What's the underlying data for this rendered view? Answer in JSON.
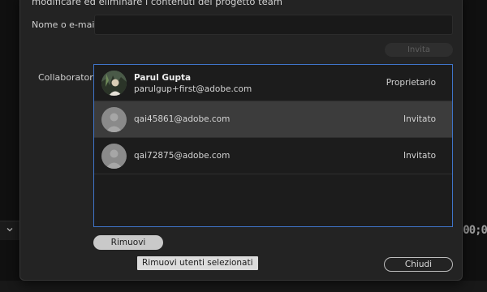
{
  "dialog": {
    "intro_text": "modificare ed eliminare i contenuti del progetto team",
    "email_label": "Nome o e-mail:",
    "email_value": "",
    "email_placeholder": "",
    "invite_label": "Invita",
    "collaborators_label": "Collaboratori:",
    "collaborators": [
      {
        "name": "Parul Gupta",
        "email": "parulgup+first@adobe.com",
        "role": "Proprietario",
        "avatar": "user-photo",
        "selected": false
      },
      {
        "name": "",
        "email": "qai45861@adobe.com",
        "role": "Invitato",
        "avatar": "user-placeholder-icon",
        "selected": true
      },
      {
        "name": "",
        "email": "qai72875@adobe.com",
        "role": "Invitato",
        "avatar": "user-placeholder-icon",
        "selected": false
      }
    ],
    "remove_label": "Rimuovi",
    "tooltip_text": "Rimuovi utenti selezionati",
    "close_label": "Chiudi"
  },
  "background": {
    "timecode_fragment": ";00;0"
  },
  "colors": {
    "dialog_bg": "#232323",
    "list_border": "#3f74c9",
    "selected_row": "#3c3c3c"
  }
}
